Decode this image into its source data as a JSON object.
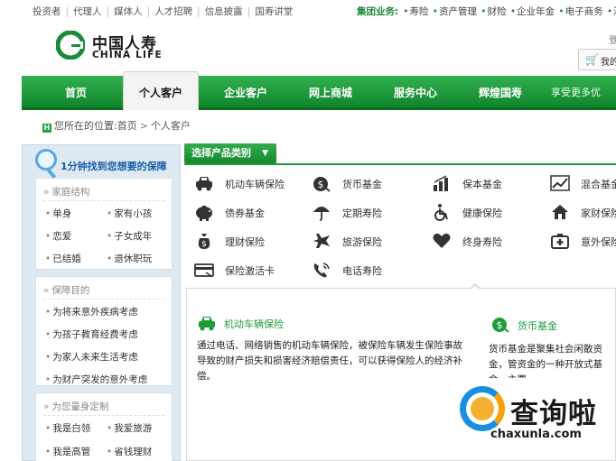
{
  "top_links": {
    "left": [
      "投资者",
      "代理人",
      "媒体人",
      "人才招聘",
      "信息披露",
      "国寿讲堂"
    ],
    "group_label": "集团业务:",
    "right": [
      "寿险",
      "资产管理",
      "财险",
      "企业年金",
      "电子商务",
      "海"
    ]
  },
  "logo": {
    "cn": "中国人寿",
    "en": "CHINA LIFE"
  },
  "cart": {
    "label": "我的",
    "edge_char": "登"
  },
  "nav": {
    "items": [
      "首页",
      "个人客户",
      "企业客户",
      "网上商城",
      "服务中心",
      "辉煌国寿",
      "享受更多优"
    ],
    "active_index": 1
  },
  "breadcrumb": {
    "prefix": "您所在的位置:",
    "home": "首页",
    "current": "个人客户"
  },
  "finder": {
    "title": "1分钟找到您想要的保障",
    "sections": [
      {
        "title": "家庭结构",
        "tags": [
          "单身",
          "家有小孩",
          "恋爱",
          "子女成年",
          "已结婚",
          "退休职玩"
        ]
      },
      {
        "title": "保障目的",
        "tags": [
          "为将来意外疾病考虑",
          "为孩子教育经费考虑",
          "为家人未来生活考虑",
          "为财产突发的意外考虑"
        ]
      },
      {
        "title": "为您量身定制",
        "tags": [
          "我是白领",
          "我爱旅游",
          "我是高管",
          "省钱理财"
        ]
      }
    ]
  },
  "product_selector": {
    "label": "选择产品类别"
  },
  "products": [
    {
      "label": "机动车辆保险",
      "icon": "car-icon"
    },
    {
      "label": "货币基金",
      "icon": "money-bag-icon"
    },
    {
      "label": "保本基金",
      "icon": "bar-chart-icon"
    },
    {
      "label": "混合基金",
      "icon": "trend-chart-icon"
    },
    {
      "label": "债券基金",
      "icon": "piggy-bank-icon"
    },
    {
      "label": "定期寿险",
      "icon": "umbrella-icon"
    },
    {
      "label": "健康保险",
      "icon": "wheelchair-icon"
    },
    {
      "label": "家财保险",
      "icon": "home-icon"
    },
    {
      "label": "理财保险",
      "icon": "money-bag-icon"
    },
    {
      "label": "旅游保险",
      "icon": "airplane-icon"
    },
    {
      "label": "终身寿险",
      "icon": "heart-icon"
    },
    {
      "label": "意外保险",
      "icon": "first-aid-icon"
    },
    {
      "label": "保险激活卡",
      "icon": "card-icon"
    },
    {
      "label": "电话寿险",
      "icon": "phone-icon"
    }
  ],
  "details": [
    {
      "title": "机动车辆保险",
      "text": "通过电话、网络销售的机动车辆保险，被保险车辆发生保险事故导致的财产损失和损害经济赔偿责任，可以获得保险人的经济补偿。"
    },
    {
      "title": "货币基金",
      "text": "货币基金是聚集社会闲散资金，管资金的一种开放式基金，主要"
    }
  ],
  "watermark": {
    "cn": "查询啦",
    "url": "chaxunla.com"
  }
}
